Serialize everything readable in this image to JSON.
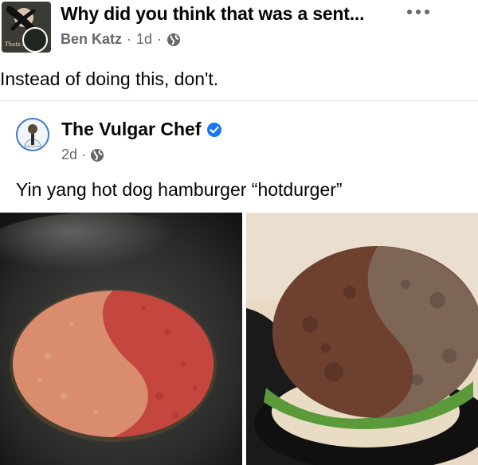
{
  "post": {
    "title": "Why did you think that was a sent...",
    "author": "Ben Katz",
    "age": "1d",
    "separator": "·",
    "text": "Instead of doing this, don't.",
    "avatar_caption": "Thats a",
    "privacy_icon": "globe-icon",
    "more_icon": "more-options-icon"
  },
  "shared": {
    "name": "The Vulgar Chef",
    "age": "2d",
    "separator": "·",
    "caption": "Yin yang hot dog hamburger “hotdurger”",
    "verified_icon": "verified-badge-icon",
    "privacy_icon": "globe-icon"
  },
  "colors": {
    "meta_text": "#65676b",
    "verified_blue": "#1877f2",
    "divider": "#dadde1"
  }
}
